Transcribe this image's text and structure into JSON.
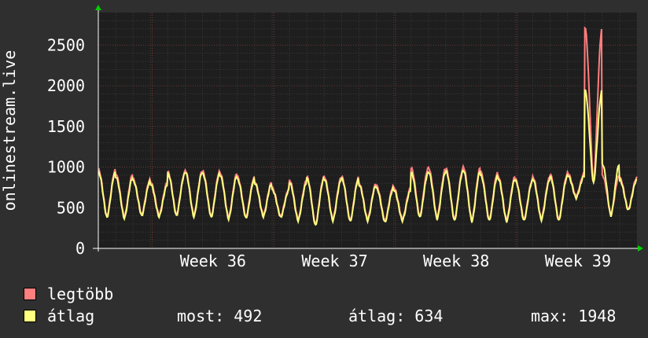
{
  "chart_data": {
    "type": "line",
    "ylabel": "onlinestream.live",
    "ylim": [
      0,
      2900
    ],
    "yticks": [
      0,
      500,
      1000,
      1500,
      2000,
      2500
    ],
    "xticks": [
      "Week 36",
      "Week 37",
      "Week 38",
      "Week 39"
    ],
    "x_days": 31,
    "series": [
      {
        "name": "legtöbb",
        "color": "#ff7f7f",
        "daily_peaks": [
          970,
          920,
          850,
          820,
          940,
          960,
          950,
          930,
          880,
          820,
          740,
          840,
          880,
          880,
          880,
          800,
          770,
          750,
          990,
          990,
          980,
          1000,
          940,
          890,
          850,
          880,
          910,
          930,
          2720,
          900,
          870
        ],
        "daily_troughs": [
          400,
          390,
          420,
          410,
          420,
          410,
          400,
          380,
          390,
          410,
          400,
          360,
          300,
          360,
          350,
          360,
          340,
          360,
          400,
          380,
          360,
          350,
          360,
          350,
          360,
          370,
          360,
          640,
          820,
          420,
          480
        ]
      },
      {
        "name": "átlag",
        "color": "#ffff80",
        "daily_peaks": [
          940,
          880,
          830,
          790,
          920,
          940,
          920,
          900,
          850,
          800,
          720,
          810,
          860,
          850,
          860,
          780,
          740,
          720,
          930,
          940,
          950,
          960,
          900,
          860,
          830,
          850,
          880,
          900,
          1948,
          1040,
          840
        ],
        "daily_troughs": [
          380,
          370,
          400,
          390,
          400,
          390,
          380,
          360,
          370,
          390,
          380,
          340,
          280,
          340,
          330,
          340,
          320,
          340,
          380,
          360,
          340,
          330,
          340,
          330,
          340,
          350,
          340,
          620,
          800,
          400,
          470
        ]
      }
    ]
  },
  "legend": [
    {
      "label": "legtöbb",
      "color": "#ff7f7f"
    },
    {
      "label": "átlag",
      "color": "#ffff80"
    }
  ],
  "stats": {
    "most": "most: 492",
    "atlag": "átlag: 634",
    "max": "max: 1948"
  }
}
